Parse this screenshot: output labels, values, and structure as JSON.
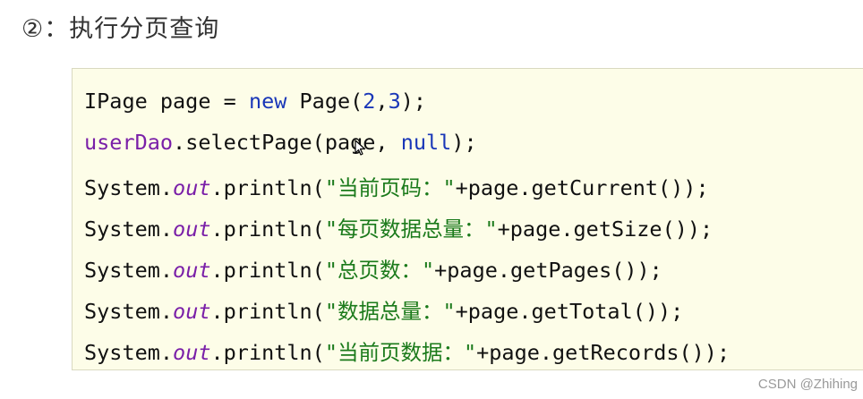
{
  "heading": "②：执行分页查询",
  "code": {
    "line1": {
      "a": "IPage page = ",
      "kw": "new",
      "b": " Page(",
      "n1": "2",
      "comma": ",",
      "n2": "3",
      "c": ");"
    },
    "line2": {
      "field": "userDao",
      "a": ".selectPage(page, ",
      "kw": "null",
      "b": ");"
    },
    "line3": {
      "a": "System.",
      "out": "out",
      "b": ".println(",
      "str": "\"当前页码：\"",
      "c": "+page.getCurrent());"
    },
    "line4": {
      "a": "System.",
      "out": "out",
      "b": ".println(",
      "str": "\"每页数据总量：\"",
      "c": "+page.getSize());"
    },
    "line5": {
      "a": "System.",
      "out": "out",
      "b": ".println(",
      "str": "\"总页数：\"",
      "c": "+page.getPages());"
    },
    "line6": {
      "a": "System.",
      "out": "out",
      "b": ".println(",
      "str": "\"数据总量：\"",
      "c": "+page.getTotal());"
    },
    "line7": {
      "a": "System.",
      "out": "out",
      "b": ".println(",
      "str": "\"当前页数据：\"",
      "c": "+page.getRecords());"
    }
  },
  "watermark": "CSDN @Zhihing",
  "colors": {
    "keyword": "#1a37b8",
    "field": "#7a1fa8",
    "string": "#1b7a1b",
    "code_background": "#fdfde8"
  },
  "icons": {
    "cursor": "mouse-cursor-icon"
  }
}
